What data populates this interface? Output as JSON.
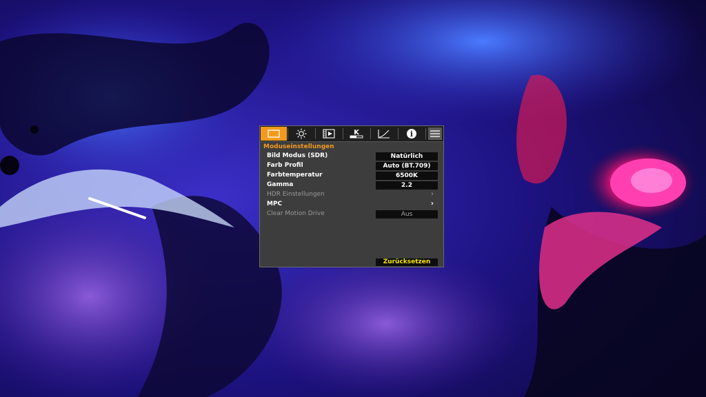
{
  "tabs": [
    {
      "icon": "picture-mode-icon",
      "active": true
    },
    {
      "icon": "brightness-icon",
      "active": false
    },
    {
      "icon": "image-adjust-icon",
      "active": false
    },
    {
      "icon": "color-temperature-icon",
      "label": "K",
      "active": false
    },
    {
      "icon": "gamma-curve-icon",
      "active": false
    },
    {
      "icon": "info-icon",
      "label": "i",
      "active": false
    },
    {
      "icon": "menu-icon",
      "active": false
    }
  ],
  "section_title": "Moduseinstellungen",
  "rows": [
    {
      "label": "Bild Modus (SDR)",
      "value": "Natürlich",
      "enabled": true
    },
    {
      "label": "Farb Profil",
      "value": "Auto (BT.709)",
      "enabled": true
    },
    {
      "label": "Farbtemperatur",
      "value": "6500K",
      "enabled": true
    },
    {
      "label": "Gamma",
      "value": "2.2",
      "enabled": true
    },
    {
      "label": "HDR Einstellungen",
      "arrow": "›",
      "enabled": false
    },
    {
      "label": "MPC",
      "arrow": "›",
      "enabled": true
    },
    {
      "label": "Clear Motion Drive",
      "value": "Aus",
      "enabled": false
    }
  ],
  "reset_label": "Zurücksetzen",
  "colors": {
    "accent": "#f39a1e",
    "reset_text": "#f5e400",
    "panel": "#3d3d3d"
  }
}
